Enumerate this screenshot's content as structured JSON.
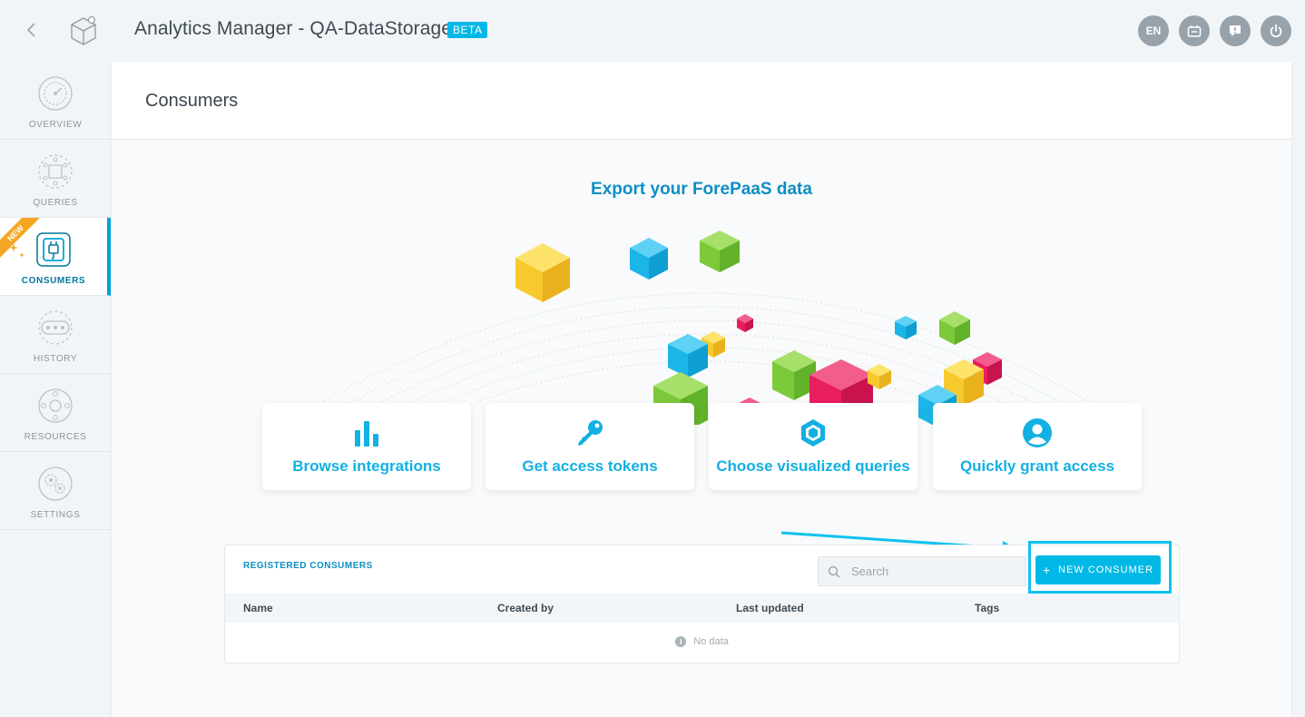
{
  "header": {
    "title": "Analytics Manager - QA-DataStorage",
    "badge": "BETA",
    "buttons": {
      "language": "EN",
      "chat_icon": "app-switch-icon",
      "feedback_icon": "feedback-icon",
      "power_icon": "power-icon"
    }
  },
  "sidebar": {
    "new_ribbon": "NEW",
    "items": [
      {
        "label": "OVERVIEW",
        "icon": "gauge-icon"
      },
      {
        "label": "QUERIES",
        "icon": "grid-icon"
      },
      {
        "label": "CONSUMERS",
        "icon": "plug-icon"
      },
      {
        "label": "HISTORY",
        "icon": "timeline-icon"
      },
      {
        "label": "RESOURCES",
        "icon": "resources-icon"
      },
      {
        "label": "SETTINGS",
        "icon": "gear-icon"
      }
    ]
  },
  "main": {
    "title": "Consumers",
    "export_title": "Export your ForePaaS data",
    "features": [
      {
        "label": "Browse integrations",
        "icon": "bar-chart-icon"
      },
      {
        "label": "Get access tokens",
        "icon": "key-icon"
      },
      {
        "label": "Choose visualized queries",
        "icon": "hexagon-icon"
      },
      {
        "label": "Quickly grant access",
        "icon": "user-icon"
      }
    ],
    "table": {
      "title": "REGISTERED CONSUMERS",
      "search_placeholder": "Search",
      "new_button": "NEW CONSUMER",
      "columns": [
        "Name",
        "Created by",
        "Last updated",
        "Tags"
      ],
      "empty_text": "No data"
    }
  },
  "colors": {
    "accent": "#00b8e6",
    "accent_dark": "#0e8fc2",
    "ribbon": "#f5a623",
    "cube_yellow": "#f8c92d",
    "cube_blue": "#1cb5e8",
    "cube_green": "#7cc93a",
    "cube_pink": "#e91e5f"
  }
}
